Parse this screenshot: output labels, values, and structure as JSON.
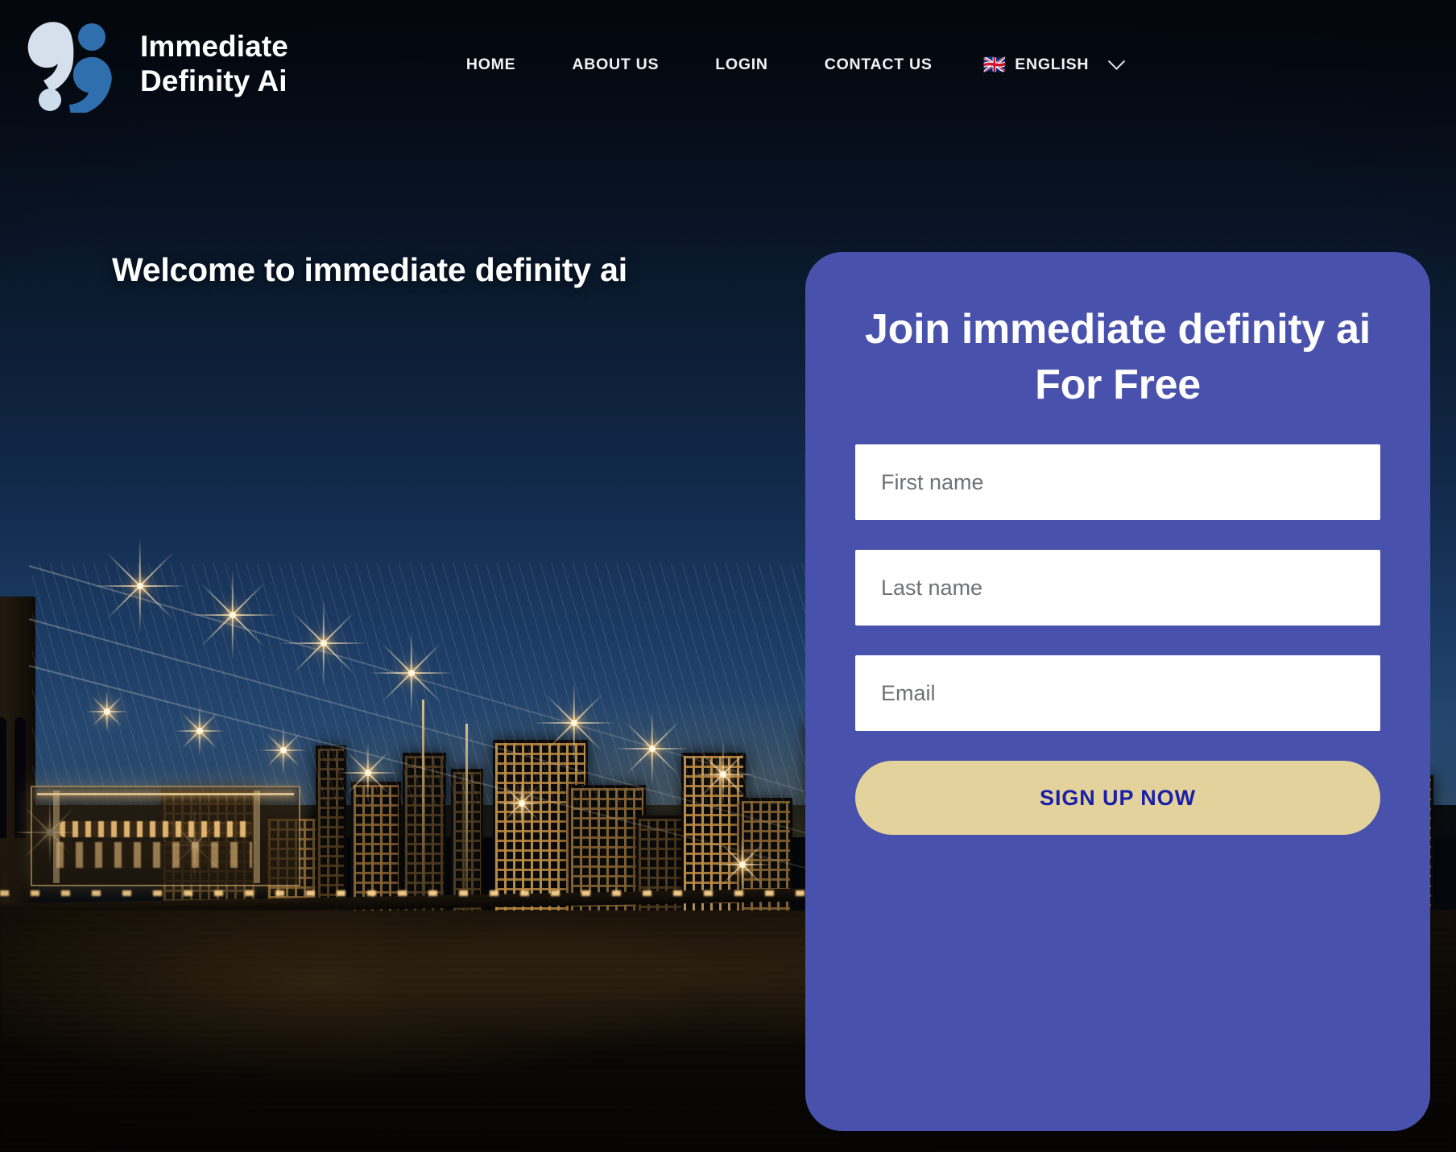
{
  "brand": {
    "name": "Immediate\nDefinity Ai",
    "logo_icon": "quote-marks-logo",
    "colors": {
      "logo_light": "#d5e0ec",
      "logo_dark": "#2f6fad"
    }
  },
  "nav": {
    "items": [
      {
        "label": "HOME",
        "name": "nav-home"
      },
      {
        "label": "ABOUT US",
        "name": "nav-about-us"
      },
      {
        "label": "LOGIN",
        "name": "nav-login"
      },
      {
        "label": "CONTACT US",
        "name": "nav-contact-us"
      }
    ],
    "language": {
      "label": "ENGLISH",
      "flag": "🇬🇧",
      "flag_icon": "uk-flag-icon",
      "chevron_icon": "chevron-down-icon"
    }
  },
  "hero": {
    "title": "Welcome to immediate definity ai",
    "background_scene": "brooklyn-bridge-nyc-skyline-night"
  },
  "signup": {
    "title": "Join immediate definity ai For Free",
    "fields": [
      {
        "name": "first-name-input",
        "placeholder": "First name",
        "value": ""
      },
      {
        "name": "last-name-input",
        "placeholder": "Last name",
        "value": ""
      },
      {
        "name": "email-input",
        "placeholder": "Email",
        "value": ""
      }
    ],
    "submit_label": "SIGN UP NOW",
    "colors": {
      "card_background": "#4852ac",
      "button_background": "#e3d29b",
      "button_text": "#1a1fa8"
    }
  }
}
